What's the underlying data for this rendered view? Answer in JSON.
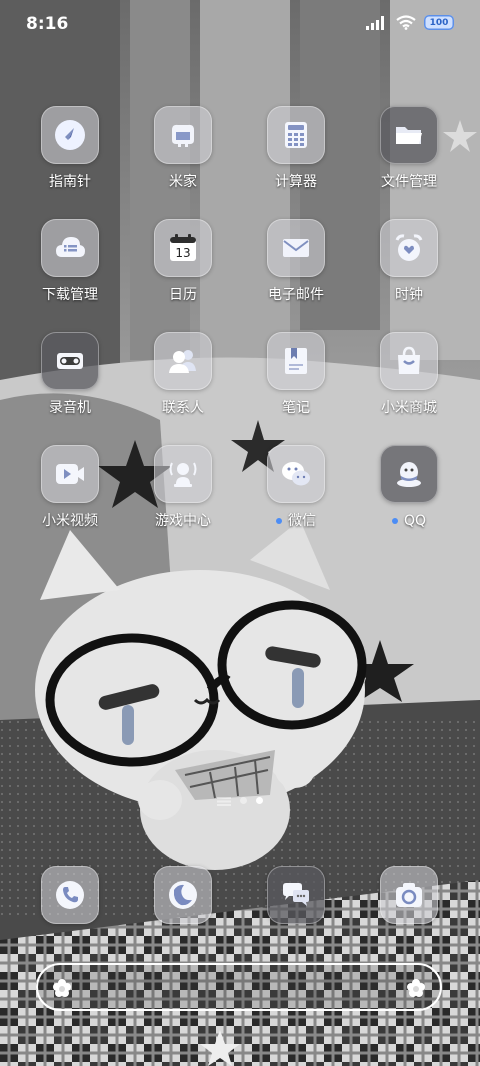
{
  "status": {
    "time": "8:16",
    "battery": "100"
  },
  "apps": [
    {
      "label": "指南针",
      "icon": "compass-icon"
    },
    {
      "label": "米家",
      "icon": "mijia-icon"
    },
    {
      "label": "计算器",
      "icon": "calculator-icon"
    },
    {
      "label": "文件管理",
      "icon": "folder-icon"
    },
    {
      "label": "下载管理",
      "icon": "download-cloud-icon"
    },
    {
      "label": "日历",
      "icon": "calendar-icon",
      "badge": "13"
    },
    {
      "label": "电子邮件",
      "icon": "mail-icon"
    },
    {
      "label": "时钟",
      "icon": "alarm-clock-icon"
    },
    {
      "label": "录音机",
      "icon": "recorder-icon"
    },
    {
      "label": "联系人",
      "icon": "contacts-icon"
    },
    {
      "label": "笔记",
      "icon": "notes-icon"
    },
    {
      "label": "小米商城",
      "icon": "shopping-bag-icon"
    },
    {
      "label": "小米视频",
      "icon": "video-icon"
    },
    {
      "label": "游戏中心",
      "icon": "game-center-icon"
    },
    {
      "label": "微信",
      "icon": "wechat-icon"
    },
    {
      "label": "QQ",
      "icon": "qq-icon"
    }
  ],
  "dock": [
    {
      "icon": "phone-icon"
    },
    {
      "icon": "browser-icon"
    },
    {
      "icon": "messages-icon"
    },
    {
      "icon": "camera-icon"
    }
  ],
  "pages": {
    "count": 2,
    "current": 2
  }
}
